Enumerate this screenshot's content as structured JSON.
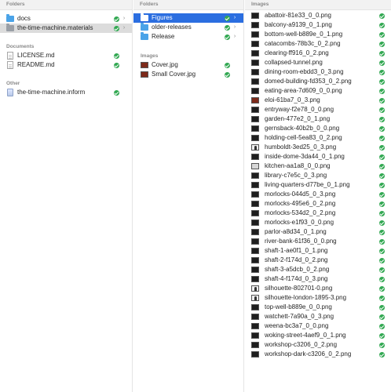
{
  "column1": {
    "folders_title": "Folders",
    "folders": [
      {
        "label": "docs",
        "icon": "folder-icon",
        "synced": true
      },
      {
        "label": "the-time-machine.materials",
        "icon": "folder-icon",
        "synced": true,
        "selected": true
      }
    ],
    "documents_title": "Documents",
    "documents": [
      {
        "label": "LICENSE.md",
        "icon": "document-icon",
        "synced": true
      },
      {
        "label": "README.md",
        "icon": "document-icon",
        "synced": true
      }
    ],
    "other_title": "Other",
    "other": [
      {
        "label": "the-time-machine.inform",
        "icon": "inform-project-icon",
        "synced": true
      }
    ]
  },
  "column2": {
    "folders_title": "Folders",
    "folders": [
      {
        "label": "Figures",
        "icon": "folder-icon",
        "synced": true,
        "selected": true
      },
      {
        "label": "older-releases",
        "icon": "folder-icon",
        "synced": true
      },
      {
        "label": "Release",
        "icon": "folder-icon",
        "synced": true
      }
    ],
    "images_title": "Images",
    "images": [
      {
        "label": "Cover.jpg",
        "icon": "image-thumbnail-icon",
        "synced": true
      },
      {
        "label": "Small Cover.jpg",
        "icon": "image-thumbnail-icon",
        "synced": true
      }
    ]
  },
  "column3": {
    "images_title": "Images",
    "images": [
      {
        "label": "abattoir-81e33_0_0.png",
        "thumb": "dark"
      },
      {
        "label": "balcony-a9139_0_1.png",
        "thumb": "dark"
      },
      {
        "label": "bottom-well-b889e_0_1.png",
        "thumb": "dark"
      },
      {
        "label": "catacombs-78b3c_0_2.png",
        "thumb": "dark"
      },
      {
        "label": "clearing-ff916_0_2.png",
        "thumb": "dark"
      },
      {
        "label": "collapsed-tunnel.png",
        "thumb": "dark"
      },
      {
        "label": "dining-room-ebdd3_0_3.png",
        "thumb": "dark"
      },
      {
        "label": "domed-building-fd353_0_2.png",
        "thumb": "dark"
      },
      {
        "label": "eating-area-7d609_0_0.png",
        "thumb": "dark"
      },
      {
        "label": "eloi-61ba7_0_3.png",
        "thumb": "red"
      },
      {
        "label": "entryway-f2e78_0_0.png",
        "thumb": "dark"
      },
      {
        "label": "garden-477e2_0_1.png",
        "thumb": "dark"
      },
      {
        "label": "gernsback-40b2b_0_0.png",
        "thumb": "dark"
      },
      {
        "label": "holding-cell-5ea83_0_2.png",
        "thumb": "dark"
      },
      {
        "label": "humboldt-3ed25_0_3.png",
        "thumb": "silhouette"
      },
      {
        "label": "inside-dome-3da44_0_1.png",
        "thumb": "dark"
      },
      {
        "label": "kitchen-aa1a8_0_0.png",
        "thumb": "light"
      },
      {
        "label": "library-c7e5c_0_3.png",
        "thumb": "dark"
      },
      {
        "label": "living-quarters-d77be_0_1.png",
        "thumb": "dark"
      },
      {
        "label": "morlocks-044d5_0_3.png",
        "thumb": "dark"
      },
      {
        "label": "morlocks-495e6_0_2.png",
        "thumb": "dark"
      },
      {
        "label": "morlocks-534d2_0_2.png",
        "thumb": "dark"
      },
      {
        "label": "morlocks-e1f93_0_0.png",
        "thumb": "dark"
      },
      {
        "label": "parlor-a8d34_0_1.png",
        "thumb": "dark"
      },
      {
        "label": "river-bank-61f36_0_0.png",
        "thumb": "dark"
      },
      {
        "label": "shaft-1-ae0f1_0_1.png",
        "thumb": "dark"
      },
      {
        "label": "shaft-2-f174d_0_2.png",
        "thumb": "dark"
      },
      {
        "label": "shaft-3-a5dcb_0_2.png",
        "thumb": "dark"
      },
      {
        "label": "shaft-4-f174d_0_3.png",
        "thumb": "dark"
      },
      {
        "label": "silhouette-802701-0.png",
        "thumb": "silhouette"
      },
      {
        "label": "silhouette-london-1895-3.png",
        "thumb": "silhouette"
      },
      {
        "label": "top-well-b889e_0_0.png",
        "thumb": "dark"
      },
      {
        "label": "watchett-7a90a_0_3.png",
        "thumb": "dark"
      },
      {
        "label": "weena-bc3a7_0_0.png",
        "thumb": "dark"
      },
      {
        "label": "woking-street-4aef9_0_1.png",
        "thumb": "dark"
      },
      {
        "label": "workshop-c3206_0_2.png",
        "thumb": "dark"
      },
      {
        "label": "workshop-dark-c3206_0_2.png",
        "thumb": "dark"
      }
    ]
  },
  "colors": {
    "selection": "#2b6ee0",
    "inactive_selection": "#dcdcdc",
    "sync_check": "#32a852",
    "folder": "#4aa3e8"
  }
}
